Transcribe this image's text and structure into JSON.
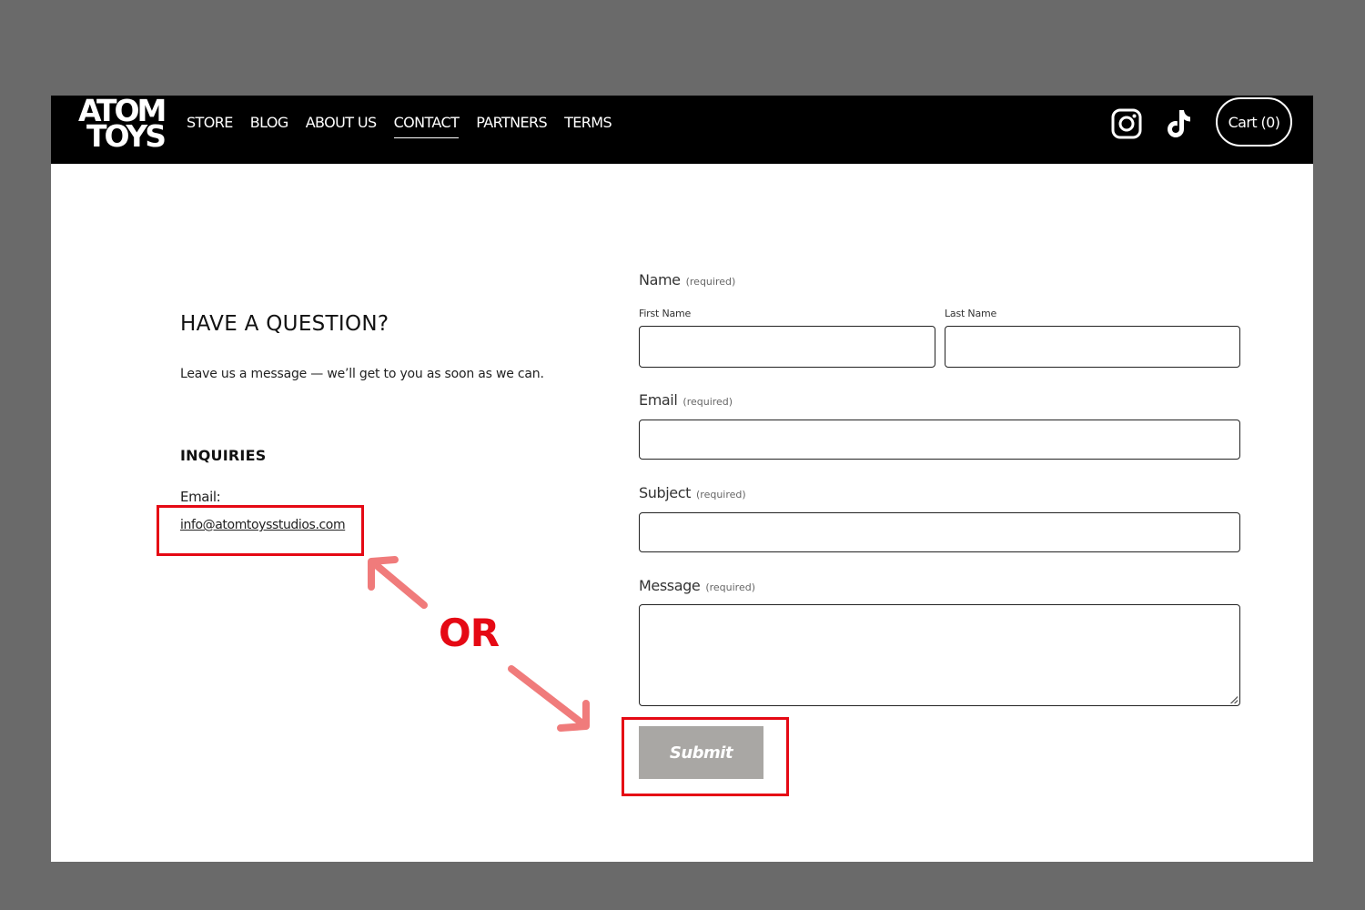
{
  "header": {
    "logo_line1": "ATOM",
    "logo_line2": "TOYS",
    "nav": [
      {
        "label": "STORE"
      },
      {
        "label": "BLOG"
      },
      {
        "label": "ABOUT US"
      },
      {
        "label": "CONTACT"
      },
      {
        "label": "PARTNERS"
      },
      {
        "label": "TERMS"
      }
    ],
    "active_nav": "CONTACT",
    "social_icons": [
      "instagram-icon",
      "tiktok-icon"
    ],
    "cart_label": "Cart (0)"
  },
  "contact_info": {
    "heading": "HAVE A QUESTION?",
    "intro": "Leave us a message — we’ll get to you as soon as we can.",
    "inquiries_heading": "INQUIRIES",
    "email_label": "Email:",
    "email_address": "info@atomtoysstudios.com"
  },
  "form": {
    "name_label": "Name",
    "required_text": "(required)",
    "first_name_label": "First Name",
    "last_name_label": "Last Name",
    "email_label": "Email",
    "subject_label": "Subject",
    "message_label": "Message",
    "first_name_value": "",
    "last_name_value": "",
    "email_value": "",
    "subject_value": "",
    "message_value": "",
    "submit_label": "Submit"
  },
  "annotation": {
    "or_text": "OR",
    "highlight_color": "#e50914",
    "arrow_color": "#f07b7b"
  }
}
